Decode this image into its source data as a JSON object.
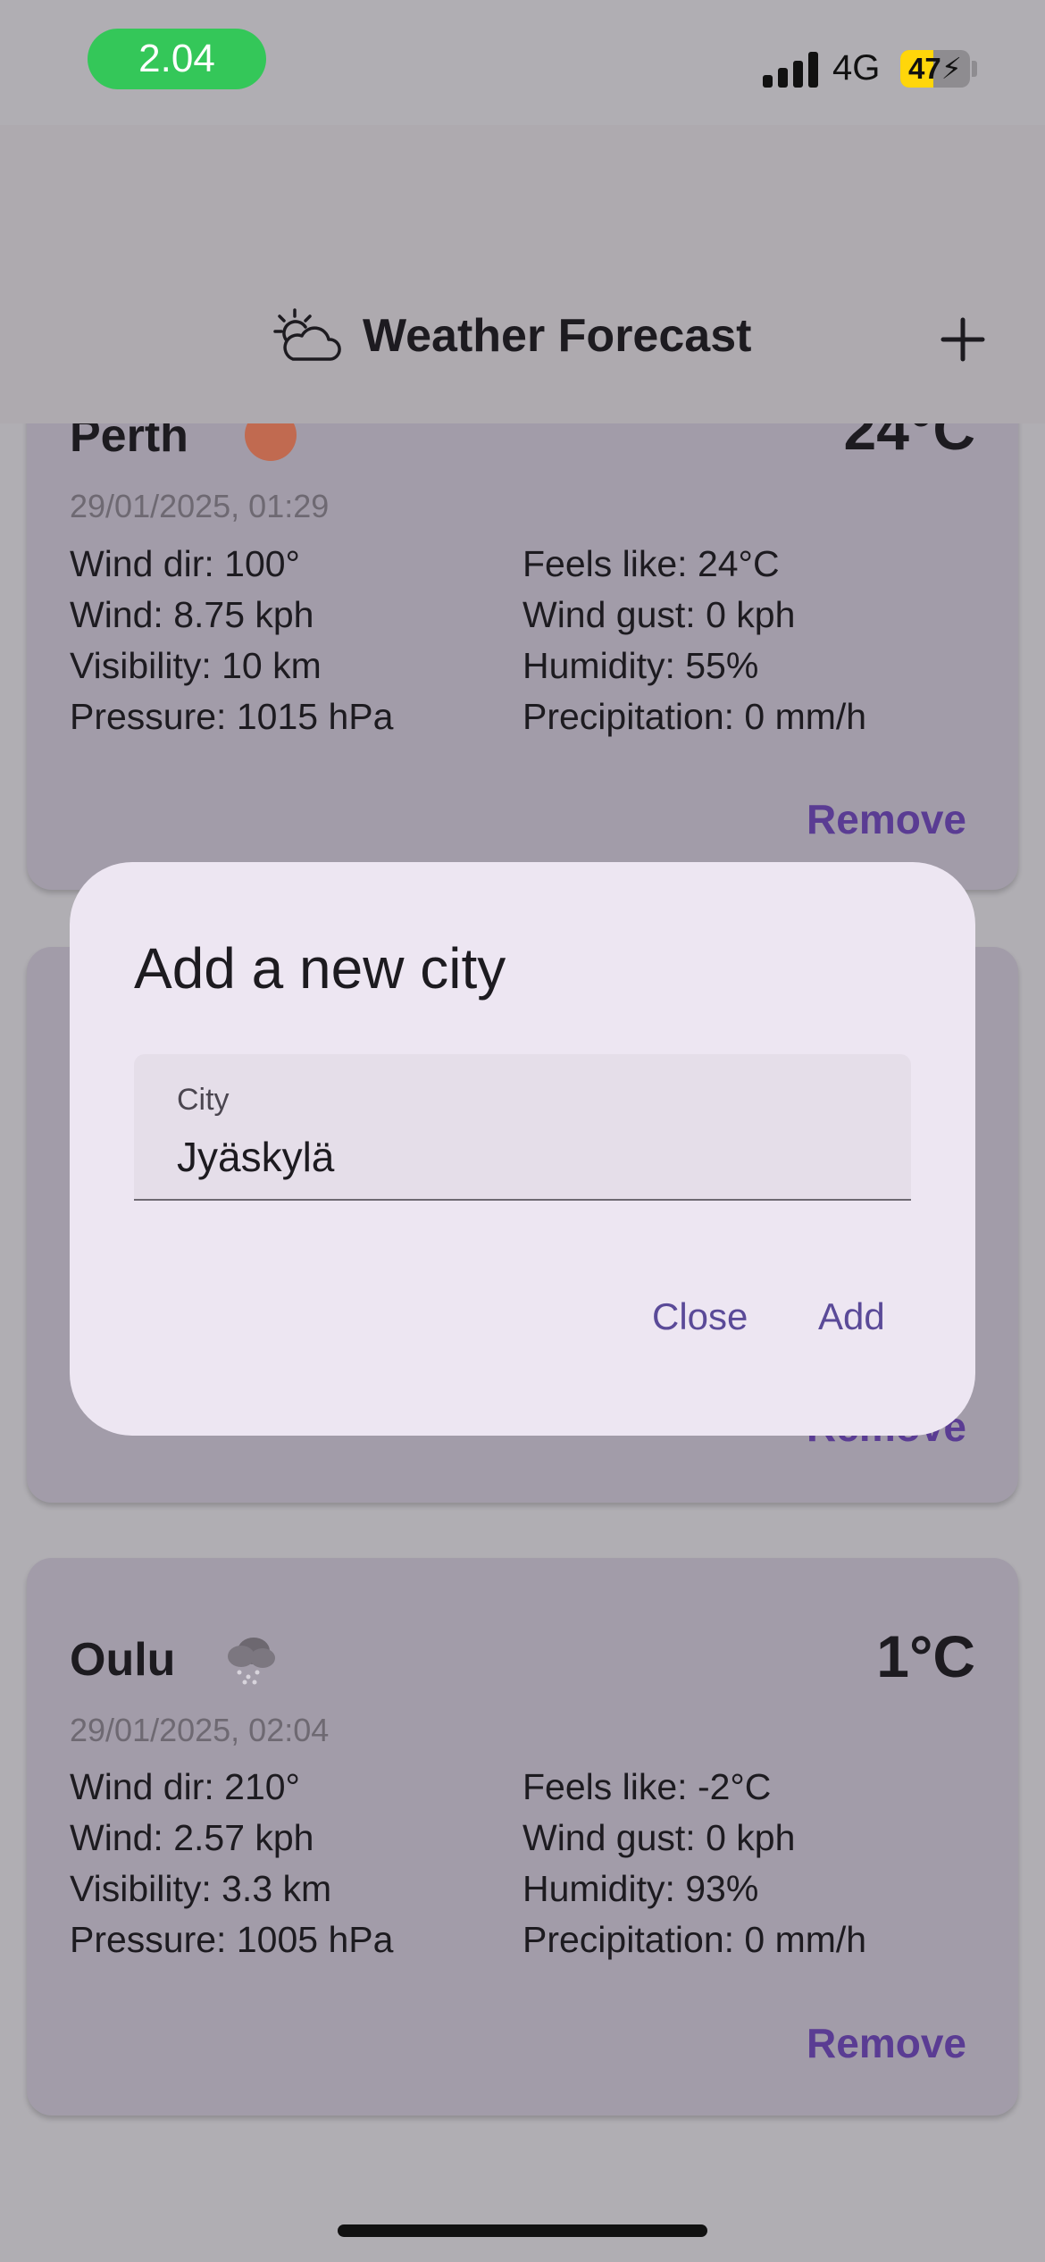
{
  "status_bar": {
    "time": "2.04",
    "network": "4G",
    "battery_percent": 47,
    "battery_label": "47",
    "battery_charging": true,
    "signal_bars": 4
  },
  "app_bar": {
    "title": "Weather Forecast",
    "logo_icon": "partly-cloudy-icon",
    "add_icon": "plus-icon"
  },
  "cards": [
    {
      "city": "Perth",
      "icon": "sunny-icon",
      "temperature": "24°C",
      "time": "29/01/2025, 01:29",
      "wind_dir": "Wind dir: 100°",
      "wind": "Wind: 8.75 kph",
      "visibility": "Visibility: 10 km",
      "pressure": "Pressure: 1015 hPa",
      "feels_like": "Feels like: 24°C",
      "wind_gust": "Wind gust: 0 kph",
      "humidity": "Humidity: 55%",
      "precipitation": "Precipitation: 0 mm/h",
      "remove_label": "Remove"
    },
    {
      "remove_label": "Remove"
    },
    {
      "city": "Oulu",
      "icon": "snow-cloud-icon",
      "temperature": "1°C",
      "time": "29/01/2025, 02:04",
      "wind_dir": "Wind dir: 210°",
      "wind": "Wind: 2.57 kph",
      "visibility": "Visibility: 3.3 km",
      "pressure": "Pressure: 1005 hPa",
      "feels_like": "Feels like: -2°C",
      "wind_gust": "Wind gust: 0 kph",
      "humidity": "Humidity: 93%",
      "precipitation": "Precipitation: 0 mm/h",
      "remove_label": "Remove"
    }
  ],
  "dialog": {
    "title": "Add a new city",
    "field_label": "City",
    "field_value": "Jyäskylä",
    "close_label": "Close",
    "add_label": "Add"
  },
  "colors": {
    "accent": "#5a3c93",
    "card_background": "#a29ca9",
    "dialog_background": "#ede6f2",
    "time_pill": "#34c759",
    "battery": "#ffd60a"
  }
}
